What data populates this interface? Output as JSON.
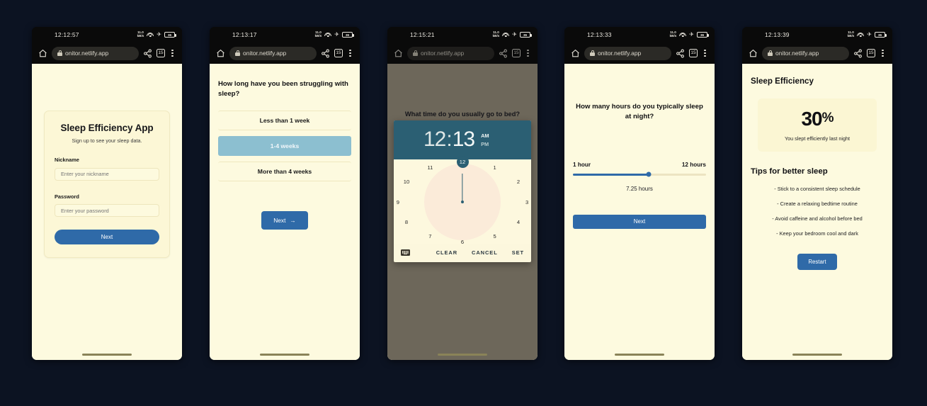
{
  "browser": {
    "url": "onitor.netlify.app",
    "tab_count": "15",
    "icons": {
      "home": "home-icon",
      "lock": "lock-icon",
      "share": "share-icon",
      "tabs": "tab-switcher-icon",
      "menu": "overflow-menu-icon"
    }
  },
  "status_icons": {
    "network_speed_top": "11.0",
    "network_speed_bottom": "kB/s",
    "wifi": "wifi-icon",
    "airplane": "✈",
    "battery_level": "36"
  },
  "phones": [
    {
      "time": "12:12:57",
      "screen": "signup",
      "app_title": "Sleep Efficiency App",
      "subtitle": "Sign up to see your sleep data.",
      "fields": [
        {
          "label": "Nickname",
          "placeholder": "Enter your nickname",
          "value": ""
        },
        {
          "label": "Password",
          "placeholder": "Enter your password",
          "value": ""
        }
      ],
      "next_label": "Next"
    },
    {
      "time": "12:13:17",
      "screen": "duration",
      "question": "How long have you been struggling with sleep?",
      "options": [
        {
          "label": "Less than 1 week",
          "selected": false
        },
        {
          "label": "1-4 weeks",
          "selected": true
        },
        {
          "label": "More than 4 weeks",
          "selected": false
        }
      ],
      "next_label": "Next",
      "next_arrow": "→"
    },
    {
      "time": "12:15:21",
      "screen": "bedtime",
      "question": "What time do you usually go to bed?",
      "time_picker": {
        "hour": "12",
        "colon": ":",
        "minute": "13",
        "am": "AM",
        "pm": "PM",
        "selected_meridiem": "AM",
        "clock_numbers": [
          "1",
          "2",
          "3",
          "4",
          "5",
          "6",
          "7",
          "8",
          "9",
          "10",
          "11",
          "12"
        ],
        "selected_number": "12",
        "keyboard_icon": "keyboard-icon",
        "clear_label": "CLEAR",
        "cancel_label": "CANCEL",
        "set_label": "SET"
      }
    },
    {
      "time": "12:13:33",
      "screen": "hours",
      "question": "How many hours do you typically sleep at night?",
      "slider": {
        "min_label": "1 hour",
        "max_label": "12 hours",
        "value_label": "7.25 hours",
        "fill_percent": 57
      },
      "next_label": "Next"
    },
    {
      "time": "12:13:39",
      "screen": "results",
      "title": "Sleep Efficiency",
      "percent": "30",
      "percent_symbol": "%",
      "caption": "You slept efficiently last night",
      "tips_title": "Tips for better sleep",
      "tips": [
        "- Stick to a consistent sleep schedule",
        "- Create a relaxing bedtime routine",
        "- Avoid caffeine and alcohol before bed",
        "- Keep your bedroom cool and dark"
      ],
      "restart_label": "Restart"
    }
  ],
  "colors": {
    "page_bg": "#fdfadf",
    "accent_blue": "#2f6aa8",
    "teal": "#2b5f73",
    "selected_option": "#8cbfd0",
    "desktop_bg": "#0c1322"
  }
}
